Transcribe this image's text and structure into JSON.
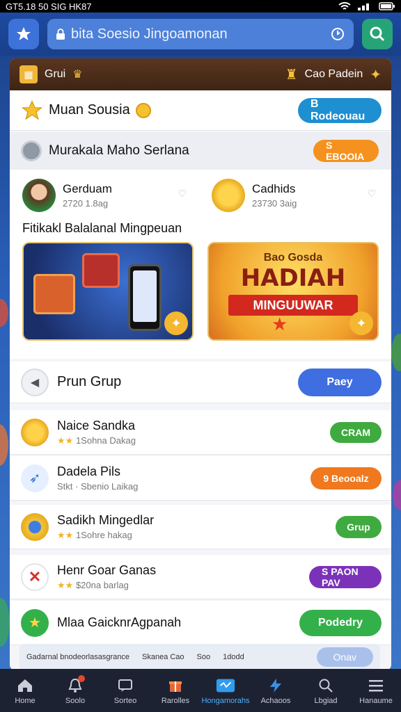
{
  "status": {
    "time": "GT5.18 50 SIG HK87"
  },
  "top": {
    "search_text": "bita Soesio Jingoamonan"
  },
  "panel_header": {
    "left": "Grui",
    "right": "Cao Padein"
  },
  "muan_row": {
    "title": "Muan Sousia",
    "button": "B Rodeouau"
  },
  "section": {
    "title": "Murakala Maho Serlana",
    "button": "S EBOOIA",
    "friends": [
      {
        "name": "Gerduam",
        "meta": "2720 1.8ag"
      },
      {
        "name": "Cadhids",
        "meta": "23730 3aig"
      }
    ],
    "subtitle": "Fitikakl Balalanal Mingpeuan",
    "promo_b": {
      "small": "Bao Gosda",
      "big": "HADIAH",
      "ribbon": "MINGUUWAR"
    }
  },
  "prun_row": {
    "title": "Prun Grup",
    "button": "Paey"
  },
  "list": [
    {
      "title": "Naice Sandka",
      "sub": "1Sohna Dakag",
      "button": "CRAM",
      "color": "#3faa3f"
    },
    {
      "title": "Dadela Pils",
      "sub": "Stkt · Sbenio Laikag",
      "button": "9 Beooalz",
      "color": "#f0781e"
    },
    {
      "title": "Sadikh Mingedlar",
      "sub": "1Sohre hakag",
      "button": "Grup",
      "color": "#3faa3f"
    },
    {
      "title": "Henr Goar Ganas",
      "sub": "$20na barlag",
      "button": "S PAON PAV",
      "color": "#7c32b8"
    },
    {
      "title": "Mlaa GaicknrAgpanah",
      "sub": "",
      "button": "Podedry",
      "color": "#34b04a"
    }
  ],
  "bottom_strip": {
    "a": "Gadarnal bnodeorlasasgrance",
    "b": "Skanea Cao",
    "c": "Soo",
    "d": "1dodd",
    "button": "Onav"
  },
  "tabs": [
    {
      "label": "Home",
      "icon": "home-icon"
    },
    {
      "label": "Soolo",
      "icon": "bell-icon"
    },
    {
      "label": "Sorteo",
      "icon": "chat-icon"
    },
    {
      "label": "Rarolles",
      "icon": "gift-icon"
    },
    {
      "label": "Hongamorahs",
      "icon": "game-icon"
    },
    {
      "label": "Achaoos",
      "icon": "bolt-icon"
    },
    {
      "label": "Lbgiad",
      "icon": "search-icon"
    },
    {
      "label": "Hanaume",
      "icon": "menu-icon"
    }
  ],
  "colors": {
    "accent": "#2f6fd8",
    "green": "#3faa3f",
    "orange": "#f0781e",
    "purple": "#7c32b8",
    "brown": "#4a2c18"
  }
}
